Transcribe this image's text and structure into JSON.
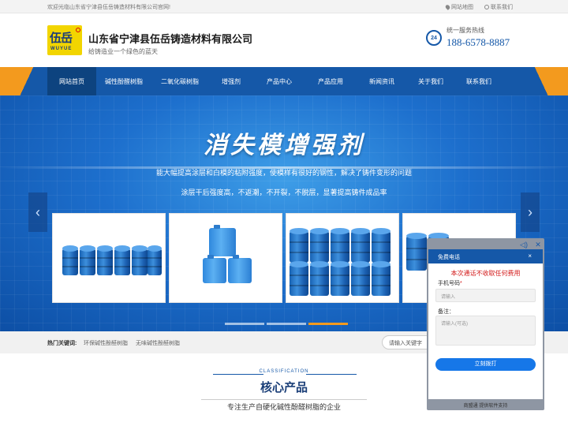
{
  "topbar": {
    "welcome": "欢迎光临山东省宁津县伍岳铸造材料有限公司官网!",
    "sitemap": "网站地图",
    "contact": "联系我们"
  },
  "header": {
    "logo_cn": "伍岳",
    "logo_en": "WUYUE",
    "company": "山东省宁津县伍岳铸造材料有限公司",
    "slogan": "给铸造业一个绿色的蓝天",
    "hotline_badge": "24",
    "hotline_label": "统一服务热线",
    "hotline_number": "188-6578-8887"
  },
  "nav": {
    "items": [
      {
        "label": "网站首页",
        "active": true
      },
      {
        "label": "碱性酚醛树脂",
        "active": false
      },
      {
        "label": "二氧化碳树脂",
        "active": false
      },
      {
        "label": "增强剂",
        "active": false
      },
      {
        "label": "产品中心",
        "active": false
      },
      {
        "label": "产品应用",
        "active": false
      },
      {
        "label": "新闻资讯",
        "active": false
      },
      {
        "label": "关于我们",
        "active": false
      },
      {
        "label": "联系我们",
        "active": false
      }
    ]
  },
  "banner": {
    "title": "消失模增强剂",
    "line1": "能大幅提高涂层和白模的粘附强度，使模样有很好的钢性，解决了铸件变形的问题",
    "line2": "涂层干后强度高，不返潮，不开裂，不脱层，显著提高铸件成品率",
    "prev_arrow": "‹",
    "next_arrow": "›"
  },
  "hotbar": {
    "label": "热门关键词:",
    "keyword1": "环保碱性酚醛树脂",
    "keyword2": "无味碱性酚醛树脂",
    "search_placeholder": "请输入关键字"
  },
  "core": {
    "classification": "CLASSIFICATION",
    "title": "核心产品",
    "desc": "专注生产自硬化碱性酚醛树脂的企业"
  },
  "popup": {
    "header": "免费电话",
    "close": "×",
    "free_note": "本次通话不收取任何费用",
    "phone_label": "手机号码",
    "required_mark": "*",
    "phone_placeholder": "请输入",
    "remark_label": "备注：",
    "remark_placeholder": "请输入(可选)",
    "call_button": "立刻拨打",
    "footer": "商盟通 提供软件支持"
  }
}
